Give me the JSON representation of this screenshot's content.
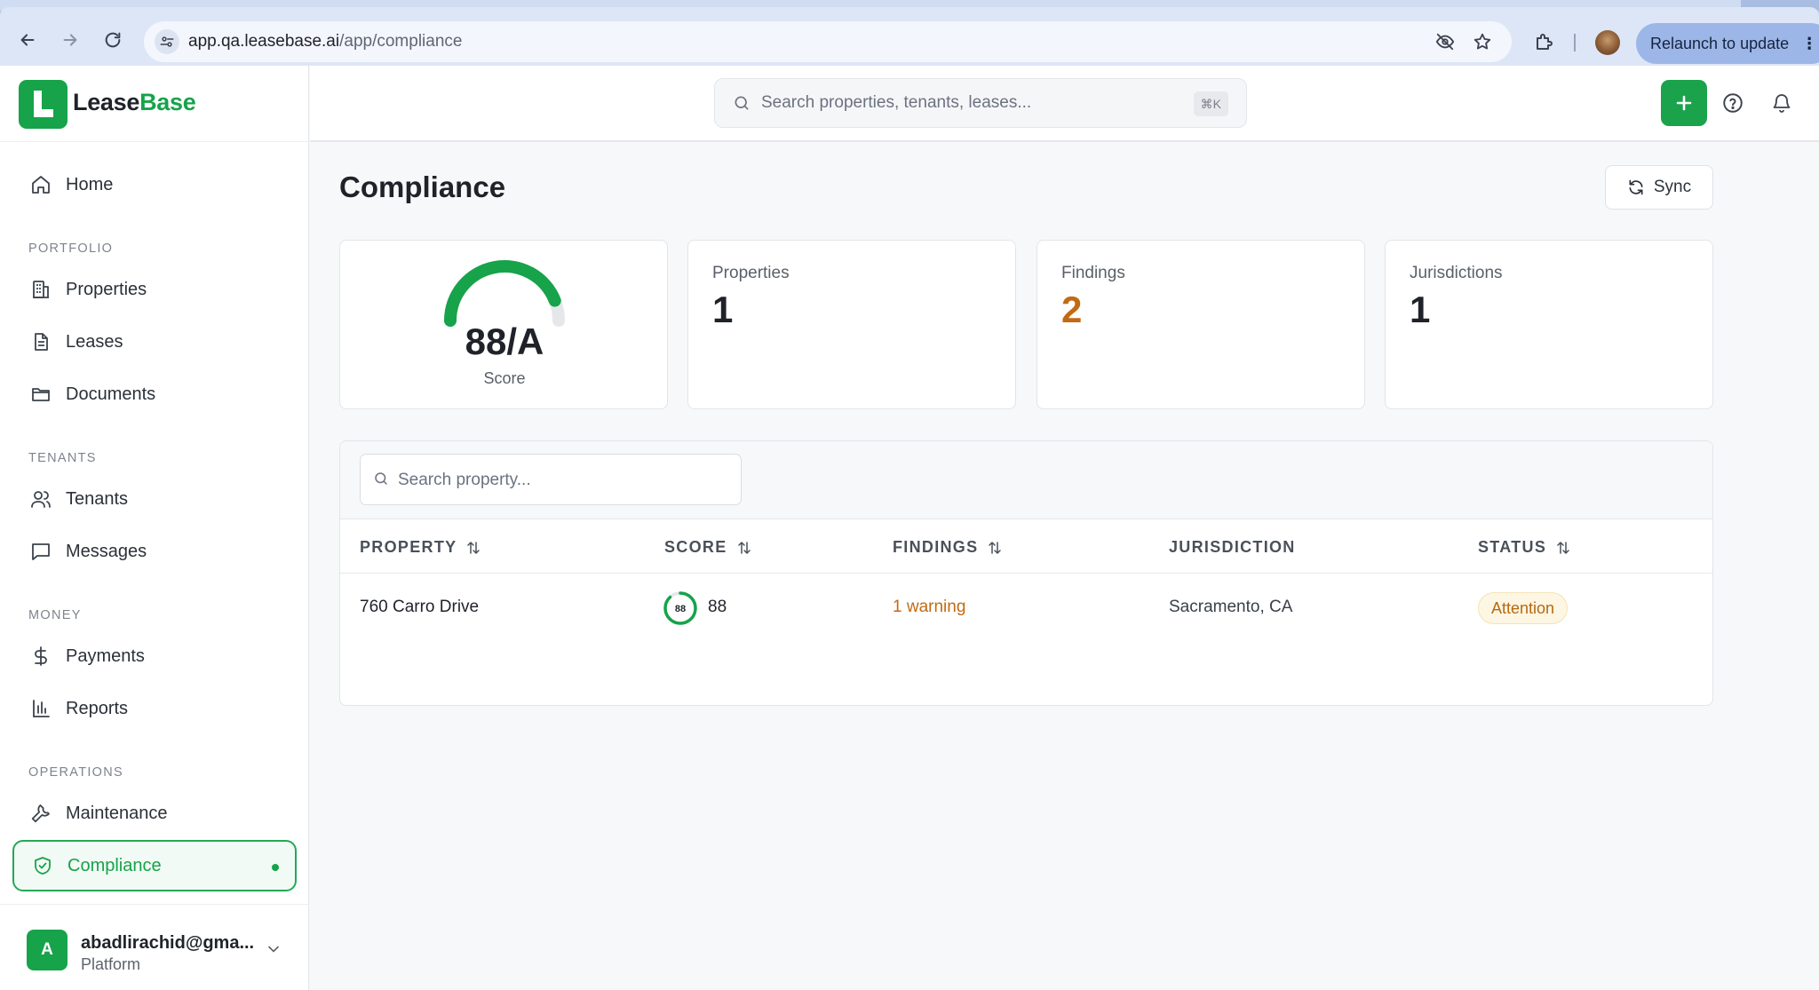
{
  "browser": {
    "url_host": "app.qa.leasebase.ai",
    "url_path": "/app/compliance",
    "relaunch_label": "Relaunch to update"
  },
  "brand": {
    "name_part1": "Lease",
    "name_part2": "Base"
  },
  "header": {
    "search_placeholder": "Search properties, tenants, leases...",
    "search_shortcut": "⌘K"
  },
  "sidebar": {
    "home": "Home",
    "sections": {
      "portfolio": "PORTFOLIO",
      "tenants": "TENANTS",
      "money": "MONEY",
      "operations": "OPERATIONS"
    },
    "items": {
      "properties": "Properties",
      "leases": "Leases",
      "documents": "Documents",
      "tenants": "Tenants",
      "messages": "Messages",
      "payments": "Payments",
      "reports": "Reports",
      "maintenance": "Maintenance",
      "compliance": "Compliance"
    },
    "user": {
      "initial": "A",
      "email": "abadlirachid@gma...",
      "role": "Platform"
    }
  },
  "page": {
    "title": "Compliance",
    "sync_label": "Sync",
    "score_card": {
      "value": "88/A",
      "label": "Score",
      "fraction": 0.88,
      "color": "#16a34a"
    },
    "stats": [
      {
        "label": "Properties",
        "value": "1"
      },
      {
        "label": "Findings",
        "value": "2"
      },
      {
        "label": "Jurisdictions",
        "value": "1"
      }
    ],
    "table": {
      "search_placeholder": "Search property...",
      "columns": [
        "PROPERTY",
        "SCORE",
        "FINDINGS",
        "JURISDICTION",
        "STATUS"
      ],
      "rows": [
        {
          "property": "760 Carro Drive",
          "score": "88",
          "score_ring_label": "88",
          "findings": "1 warning",
          "jurisdiction": "Sacramento, CA",
          "status": "Attention"
        }
      ]
    }
  },
  "colors": {
    "accent": "#16a34a",
    "warning": "#c26a12",
    "attention_bg": "#fdf6e3"
  }
}
